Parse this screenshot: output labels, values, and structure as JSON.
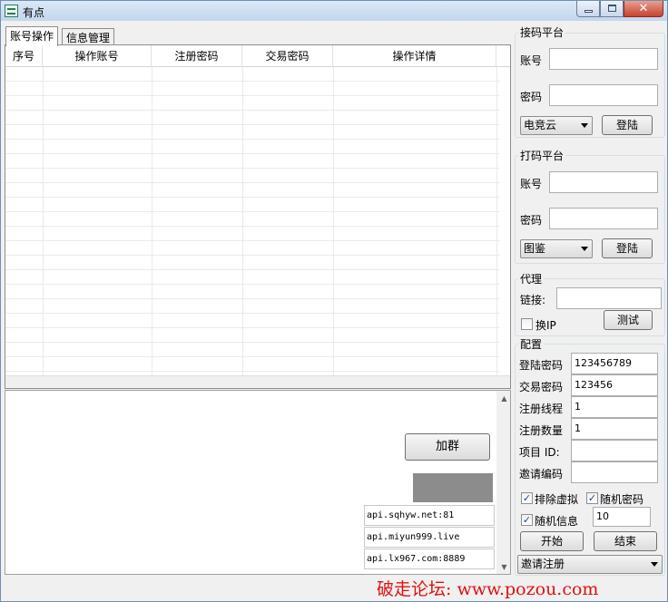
{
  "window": {
    "title": "有点",
    "close_glyph": "✕"
  },
  "tabs": [
    {
      "label": "账号操作",
      "active": true
    },
    {
      "label": "信息管理",
      "active": false
    }
  ],
  "table": {
    "columns": [
      "序号",
      "操作账号",
      "注册密码",
      "交易密码",
      "操作详情"
    ]
  },
  "buttons": {
    "add_group": "加群"
  },
  "api_list": [
    "api.sqhyw.net:81",
    "api.miyun999.live",
    "api.lx967.com:8889"
  ],
  "watermark": "破走论坛: www.pozou.com",
  "sms_platform": {
    "title": "接码平台",
    "account_label": "账号",
    "password_label": "密码",
    "provider": "电竞云",
    "login_label": "登陆"
  },
  "captcha_platform": {
    "title": "打码平台",
    "account_label": "账号",
    "password_label": "密码",
    "provider": "图鉴",
    "login_label": "登陆"
  },
  "proxy": {
    "title": "代理",
    "link_label": "链接:",
    "change_ip_label": "换IP",
    "change_ip_checked": false,
    "test_label": "测试"
  },
  "config": {
    "title": "配置",
    "login_password_label": "登陆密码",
    "login_password": "123456789",
    "trade_password_label": "交易密码",
    "trade_password": "123456",
    "register_threads_label": "注册线程",
    "register_threads": "1",
    "register_count_label": "注册数量",
    "register_count": "1",
    "project_id_label": "项目 ID:",
    "project_id": "",
    "invite_code_label": "邀请编码",
    "invite_code": "",
    "exclude_virtual_label": "排除虚拟",
    "exclude_virtual_checked": true,
    "random_password_label": "随机密码",
    "random_password_checked": true,
    "random_info_label": "随机信息",
    "random_info_checked": true,
    "random_info_value": "10",
    "start_label": "开始",
    "end_label": "结束",
    "mode": "邀请注册"
  },
  "icons": {
    "checkmark": "✓",
    "scroll_up": "▲",
    "scroll_down": "▼"
  }
}
